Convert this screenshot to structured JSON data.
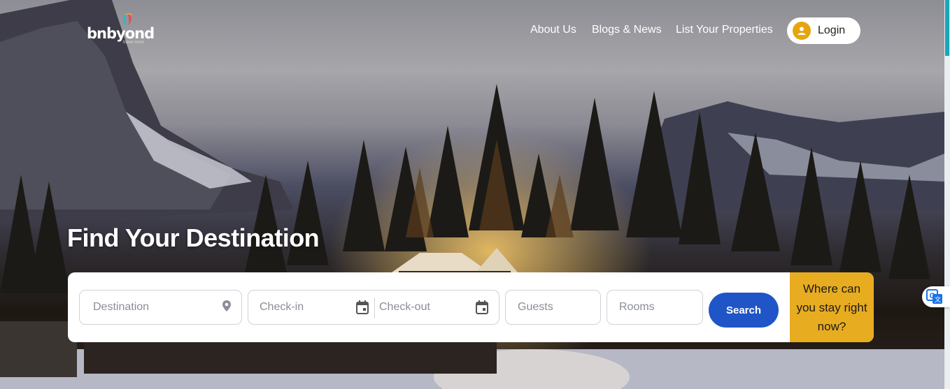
{
  "brand": {
    "name": "bnbyond",
    "tagline": "travel more"
  },
  "nav": {
    "items": [
      "About Us",
      "Blogs & News",
      "List Your Properties"
    ],
    "login_label": "Login"
  },
  "hero": {
    "headline": "Find Your Destination"
  },
  "search": {
    "destination_placeholder": "Destination",
    "checkin_placeholder": "Check-in",
    "checkout_placeholder": "Check-out",
    "guests_placeholder": "Guests",
    "rooms_placeholder": "Rooms",
    "search_label": "Search"
  },
  "promo": {
    "text": "Where can you stay right now?"
  },
  "icons": {
    "destination": "location-pin-icon",
    "checkin": "calendar-icon",
    "checkout": "calendar-icon",
    "login": "user-icon",
    "translate": "translate-icon"
  },
  "colors": {
    "accent_blue": "#1f55c7",
    "promo_yellow": "#e8ac21",
    "avatar_orange": "#e6a40d",
    "scrollbar_teal": "#18a6b8"
  }
}
